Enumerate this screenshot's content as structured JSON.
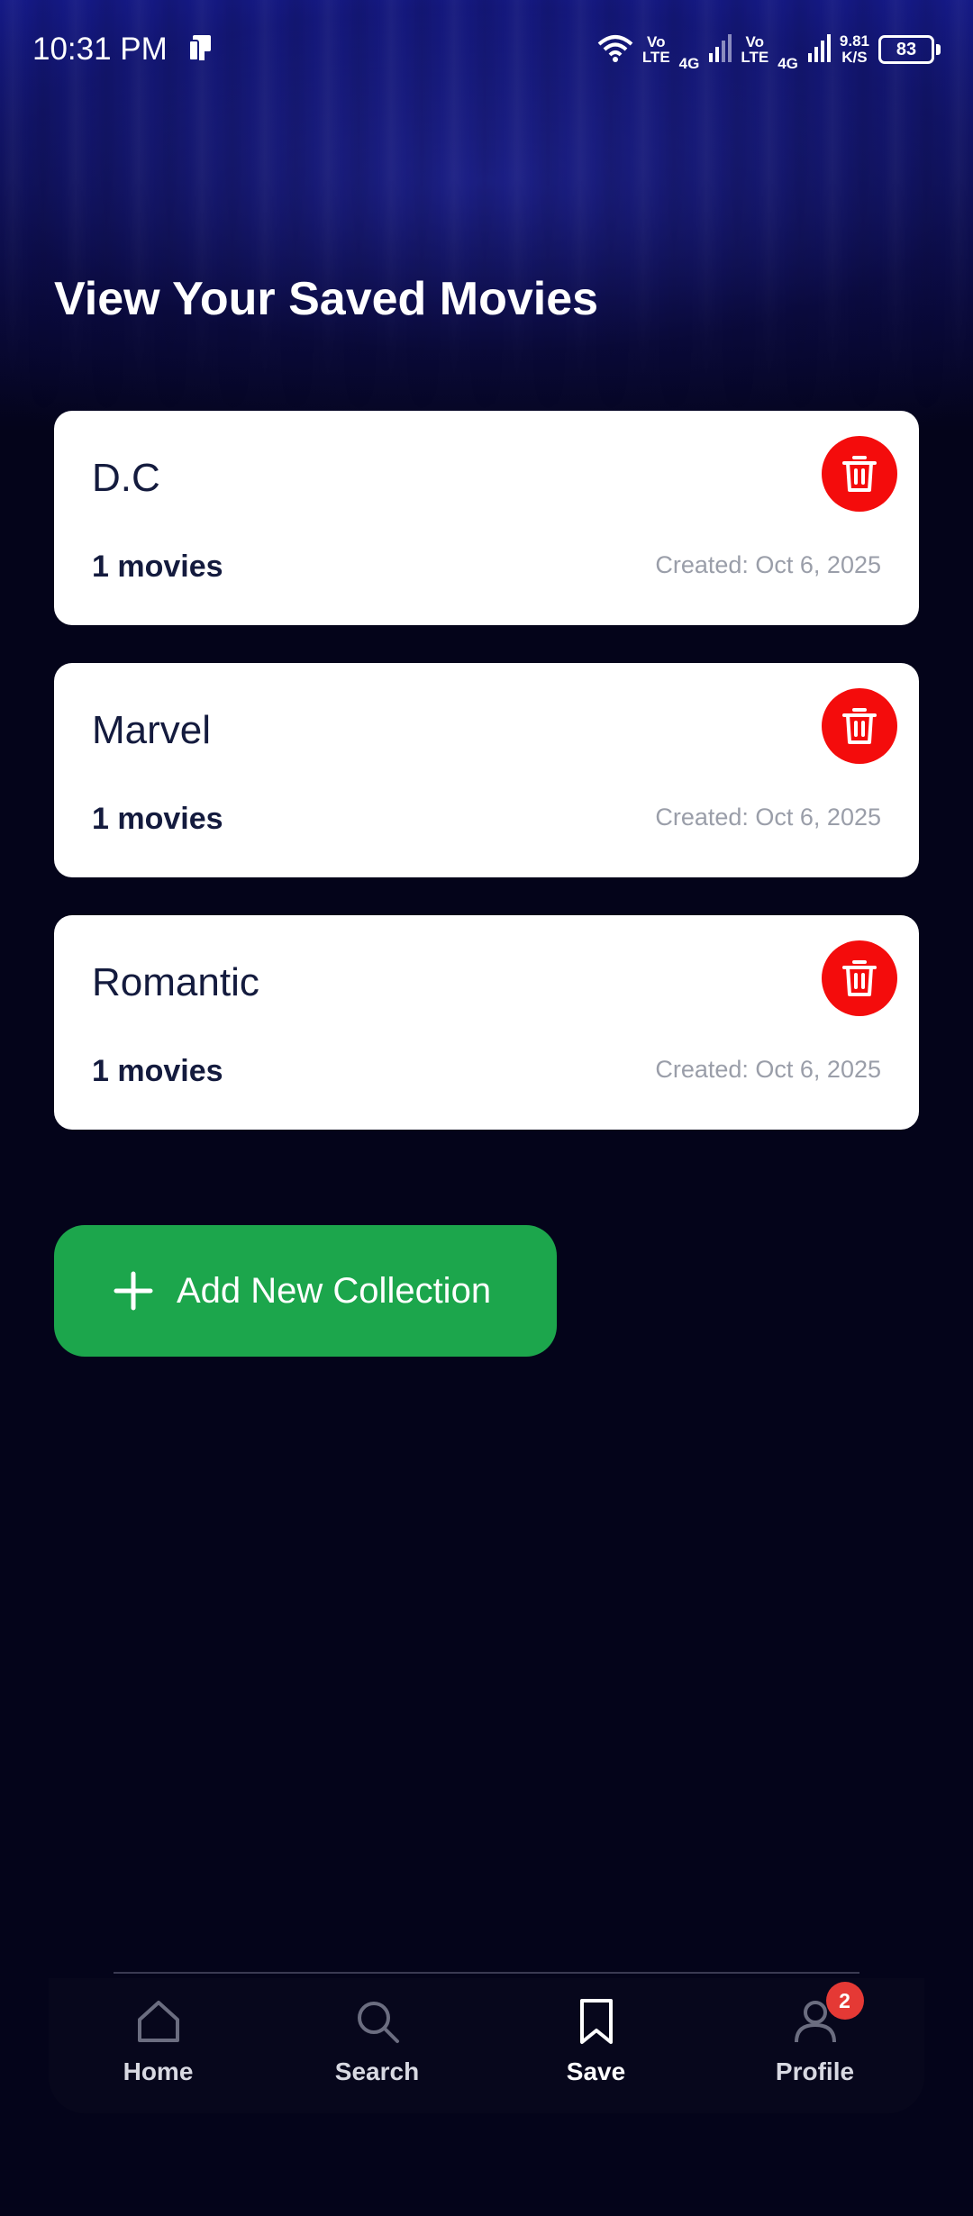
{
  "status_bar": {
    "time": "10:31 PM",
    "net1_top": "Vo",
    "net1_bottom": "LTE",
    "net1_gen": "4G",
    "net2_top": "Vo",
    "net2_bottom": "LTE",
    "net2_gen": "4G",
    "speed_value": "9.81",
    "speed_unit": "K/S",
    "battery": "83"
  },
  "page": {
    "title": "View Your Saved Movies"
  },
  "collections": [
    {
      "name": "D.C",
      "count": "1 movies",
      "created": "Created: Oct 6, 2025"
    },
    {
      "name": "Marvel",
      "count": "1 movies",
      "created": "Created: Oct 6, 2025"
    },
    {
      "name": "Romantic",
      "count": "1 movies",
      "created": "Created: Oct 6, 2025"
    }
  ],
  "add_button": {
    "label": "Add New Collection"
  },
  "bottom_nav": {
    "items": [
      {
        "label": "Home",
        "icon": "home-icon"
      },
      {
        "label": "Search",
        "icon": "search-icon"
      },
      {
        "label": "Save",
        "icon": "bookmark-icon",
        "active": true
      },
      {
        "label": "Profile",
        "icon": "user-icon",
        "badge": "2"
      }
    ]
  },
  "colors": {
    "delete": "#f40c0c",
    "add": "#1ca64c",
    "card_text": "#141b3e",
    "background": "#04041a"
  }
}
